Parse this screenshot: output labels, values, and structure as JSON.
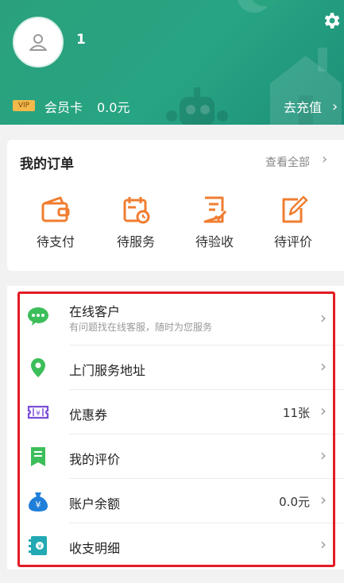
{
  "header": {
    "username": "1",
    "vip_badge": "VIP",
    "vip_label": "会员卡",
    "vip_balance": "0.0元",
    "recharge_label": "去充值",
    "chevron": "›",
    "gear_icon": "gear-icon",
    "avatar_icon": "user-icon",
    "colors": {
      "header_bg": "#27a483",
      "vip_gold": "#f3b94a"
    }
  },
  "orders": {
    "title": "我的订单",
    "view_all": "查看全部",
    "chevron": "›",
    "items": [
      {
        "label": "待支付",
        "icon": "wallet-icon"
      },
      {
        "label": "待服务",
        "icon": "calendar-clock-icon"
      },
      {
        "label": "待验收",
        "icon": "checklist-icon"
      },
      {
        "label": "待评价",
        "icon": "edit-icon"
      }
    ],
    "icon_color": "#f07d30"
  },
  "menu": {
    "items": [
      {
        "title": "在线客户",
        "subtitle": "有问题找在线客服，随时为您服务",
        "value": "",
        "icon": "chat-icon"
      },
      {
        "title": "上门服务地址",
        "subtitle": "",
        "value": "",
        "icon": "location-icon"
      },
      {
        "title": "优惠券",
        "subtitle": "",
        "value": "11张",
        "icon": "coupon-icon"
      },
      {
        "title": "我的评价",
        "subtitle": "",
        "value": "",
        "icon": "review-icon"
      },
      {
        "title": "账户余额",
        "subtitle": "",
        "value": "0.0元",
        "icon": "money-bag-icon"
      },
      {
        "title": "收支明细",
        "subtitle": "",
        "value": "",
        "icon": "ledger-icon"
      }
    ],
    "chevron": "›",
    "highlight_color": "#e31b25"
  }
}
